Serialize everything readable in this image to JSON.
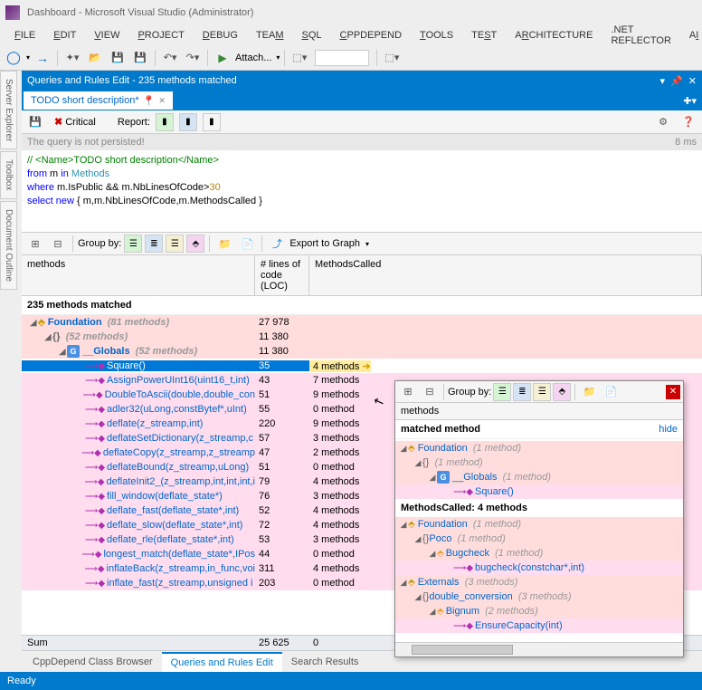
{
  "window": {
    "title": "Dashboard - Microsoft Visual Studio (Administrator)"
  },
  "menu": [
    "FILE",
    "EDIT",
    "VIEW",
    "PROJECT",
    "DEBUG",
    "TEAM",
    "SQL",
    "CPPDEPEND",
    "TOOLS",
    "TEST",
    "ARCHITECTURE",
    ".NET REFLECTOR",
    "AI"
  ],
  "toolbar": {
    "attach": "Attach..."
  },
  "side": [
    "Server Explorer",
    "Toolbox",
    "Document Outline"
  ],
  "panel": {
    "title": "Queries and Rules Edit  - 235 methods matched",
    "tab": "TODO short description*"
  },
  "et": {
    "critical": "Critical",
    "report": "Report:"
  },
  "status": {
    "left": "The query is not persisted!",
    "right": "8 ms"
  },
  "code": {
    "l1a": "// <Name>",
    "l1b": "TODO short description",
    "l1c": "</Name>",
    "l2a": "from",
    "l2b": " m ",
    "l2c": "in",
    "l2d": " Methods",
    "l3a": "where",
    "l3b": " m.IsPublic && m.NbLinesOfCode>",
    "l3c": "30",
    "l4a": "select",
    "l4b": " new",
    "l4c": " { m,m.NbLinesOfCode,m.MethodsCalled }"
  },
  "grid_tb": {
    "groupby": "Group by:",
    "export": "Export to Graph"
  },
  "cols": {
    "c1": "methods",
    "c2": "# lines of code (LOC)",
    "c3": "MethodsCalled"
  },
  "match": "235 methods matched",
  "nodes": {
    "foundation": "Foundation",
    "foundation_m": "(81 methods)",
    "foundation_loc": "27 978",
    "anon": "{}",
    "anon_m": "(52 methods)",
    "anon_loc": "11 380",
    "globals": "__Globals",
    "globals_m": "(52 methods)",
    "globals_loc": "11 380"
  },
  "rows": [
    {
      "name": "Square()",
      "loc": "35",
      "mc": "4 methods",
      "sel": true,
      "hl": true
    },
    {
      "name": "AssignPowerUInt16(uint16_t,int)",
      "loc": "43",
      "mc": "7 methods"
    },
    {
      "name": "DoubleToAscii(double,double_con",
      "loc": "51",
      "mc": "9 methods"
    },
    {
      "name": "adler32(uLong,constBytef*,uInt)",
      "loc": "55",
      "mc": "0 method"
    },
    {
      "name": "deflate(z_streamp,int)",
      "loc": "220",
      "mc": "9 methods"
    },
    {
      "name": "deflateSetDictionary(z_streamp,c",
      "loc": "57",
      "mc": "3 methods"
    },
    {
      "name": "deflateCopy(z_streamp,z_streamp",
      "loc": "47",
      "mc": "2 methods"
    },
    {
      "name": "deflateBound(z_streamp,uLong)",
      "loc": "51",
      "mc": "0 method"
    },
    {
      "name": "deflateInit2_(z_streamp,int,int,int,i",
      "loc": "79",
      "mc": "4 methods"
    },
    {
      "name": "fill_window(deflate_state*)",
      "loc": "76",
      "mc": "3 methods"
    },
    {
      "name": "deflate_fast(deflate_state*,int)",
      "loc": "52",
      "mc": "4 methods"
    },
    {
      "name": "deflate_slow(deflate_state*,int)",
      "loc": "72",
      "mc": "4 methods"
    },
    {
      "name": "deflate_rle(deflate_state*,int)",
      "loc": "53",
      "mc": "3 methods"
    },
    {
      "name": "longest_match(deflate_state*,IPos",
      "loc": "44",
      "mc": "0 method"
    },
    {
      "name": "inflateBack(z_streamp,in_func,voi",
      "loc": "311",
      "mc": "4 methods"
    },
    {
      "name": "inflate_fast(z_streamp,unsigned i",
      "loc": "203",
      "mc": "0 method"
    }
  ],
  "sum": {
    "label": "Sum",
    "loc": "25 625",
    "mc": "0"
  },
  "btabs": {
    "a": "CppDepend Class Browser",
    "b": "Queries and Rules Edit",
    "c": "Search Results"
  },
  "ready": "Ready",
  "popup": {
    "groupby": "Group by:",
    "hdr": "methods",
    "matched": "matched method",
    "hide": "hide",
    "mc_title": "MethodsCalled:  4 methods",
    "t1": {
      "foundation": "Foundation",
      "m1": "(1 method)",
      "anon": "{}",
      "globals": "__Globals",
      "square": "Square()"
    },
    "t2": {
      "foundation": "Foundation",
      "m1": "(1 method)",
      "anon": "{}",
      "poco": "Poco",
      "bugcheck": "Bugcheck",
      "bugmeth": "bugcheck(constchar*,int)"
    },
    "t3": {
      "ext": "Externals",
      "m3": "(3 methods)",
      "anon": "{}",
      "dc": "double_conversion",
      "bignum": "Bignum",
      "m2": "(2 methods)",
      "ensure": "EnsureCapacity(int)"
    }
  }
}
